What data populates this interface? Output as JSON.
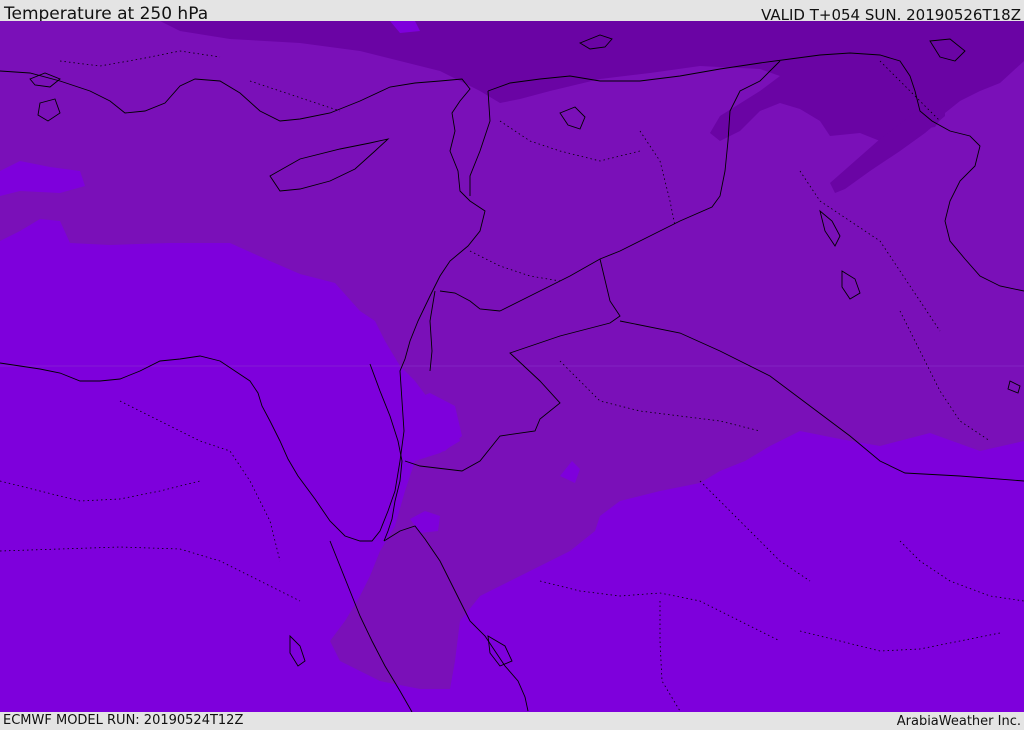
{
  "header": {
    "title": "Temperature at 250 hPa",
    "valid": "VALID T+054 SUN. 20190526T18Z"
  },
  "footer": {
    "model_run": "ECMWF MODEL RUN: 20190524T12Z",
    "credit": "ArabiaWeather Inc."
  },
  "map": {
    "colors": {
      "warm_band": "#7e00dc",
      "mid_band": "#7a10b8",
      "cool_band": "#6a04a4",
      "coast_line": "#000000"
    }
  }
}
